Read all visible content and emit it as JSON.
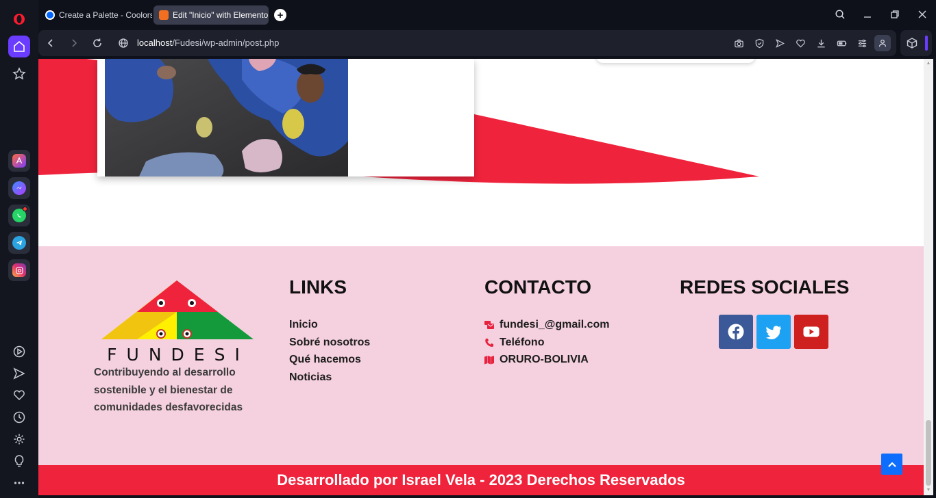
{
  "browser": {
    "tabs": [
      {
        "title": "Create a Palette - Coolors",
        "active": false
      },
      {
        "title": "Edit \"Inicio\" with Elemento",
        "active": true
      }
    ],
    "new_tab_symbol": "+",
    "url_host": "localhost",
    "url_path": "/Fudesi/wp-admin/post.php",
    "accent": "#6a3cff"
  },
  "sidebar": {
    "opera_logo": "O",
    "apps": [
      "aria-icon",
      "messenger-icon",
      "whatsapp-icon",
      "telegram-icon",
      "instagram-icon"
    ],
    "bottom_icons": [
      "player-icon",
      "send-icon",
      "heart-icon",
      "history-icon",
      "settings-icon",
      "lightbulb-icon",
      "more-icon"
    ]
  },
  "footer": {
    "logo_text": "FUNDESI",
    "tagline": "Contribuyendo al desarrollo sostenible y el bienestar de comunidades desfavorecidas",
    "links": {
      "title": "LINKS",
      "items": [
        "Inicio",
        "Sobré nosotros",
        "Qué hacemos",
        "Noticias"
      ]
    },
    "contact": {
      "title": "CONTACTO",
      "items": [
        {
          "icon": "mail-bulk-icon",
          "text": "fundesi_@gmail.com"
        },
        {
          "icon": "phone-icon",
          "text": "Teléfono"
        },
        {
          "icon": "map-icon",
          "text": "ORURO-BOLIVIA"
        }
      ]
    },
    "social": {
      "title": "REDES SOCIALES",
      "items": [
        {
          "icon": "facebook-icon",
          "color": "#3b5998"
        },
        {
          "icon": "twitter-icon",
          "color": "#1da1f2"
        },
        {
          "icon": "youtube-icon",
          "color": "#cd201f"
        }
      ]
    },
    "copyright": "Desarrollado por Israel Vela - 2023 Derechos Reservados",
    "background": "#f5d0de",
    "bar_color": "#ef233c"
  }
}
